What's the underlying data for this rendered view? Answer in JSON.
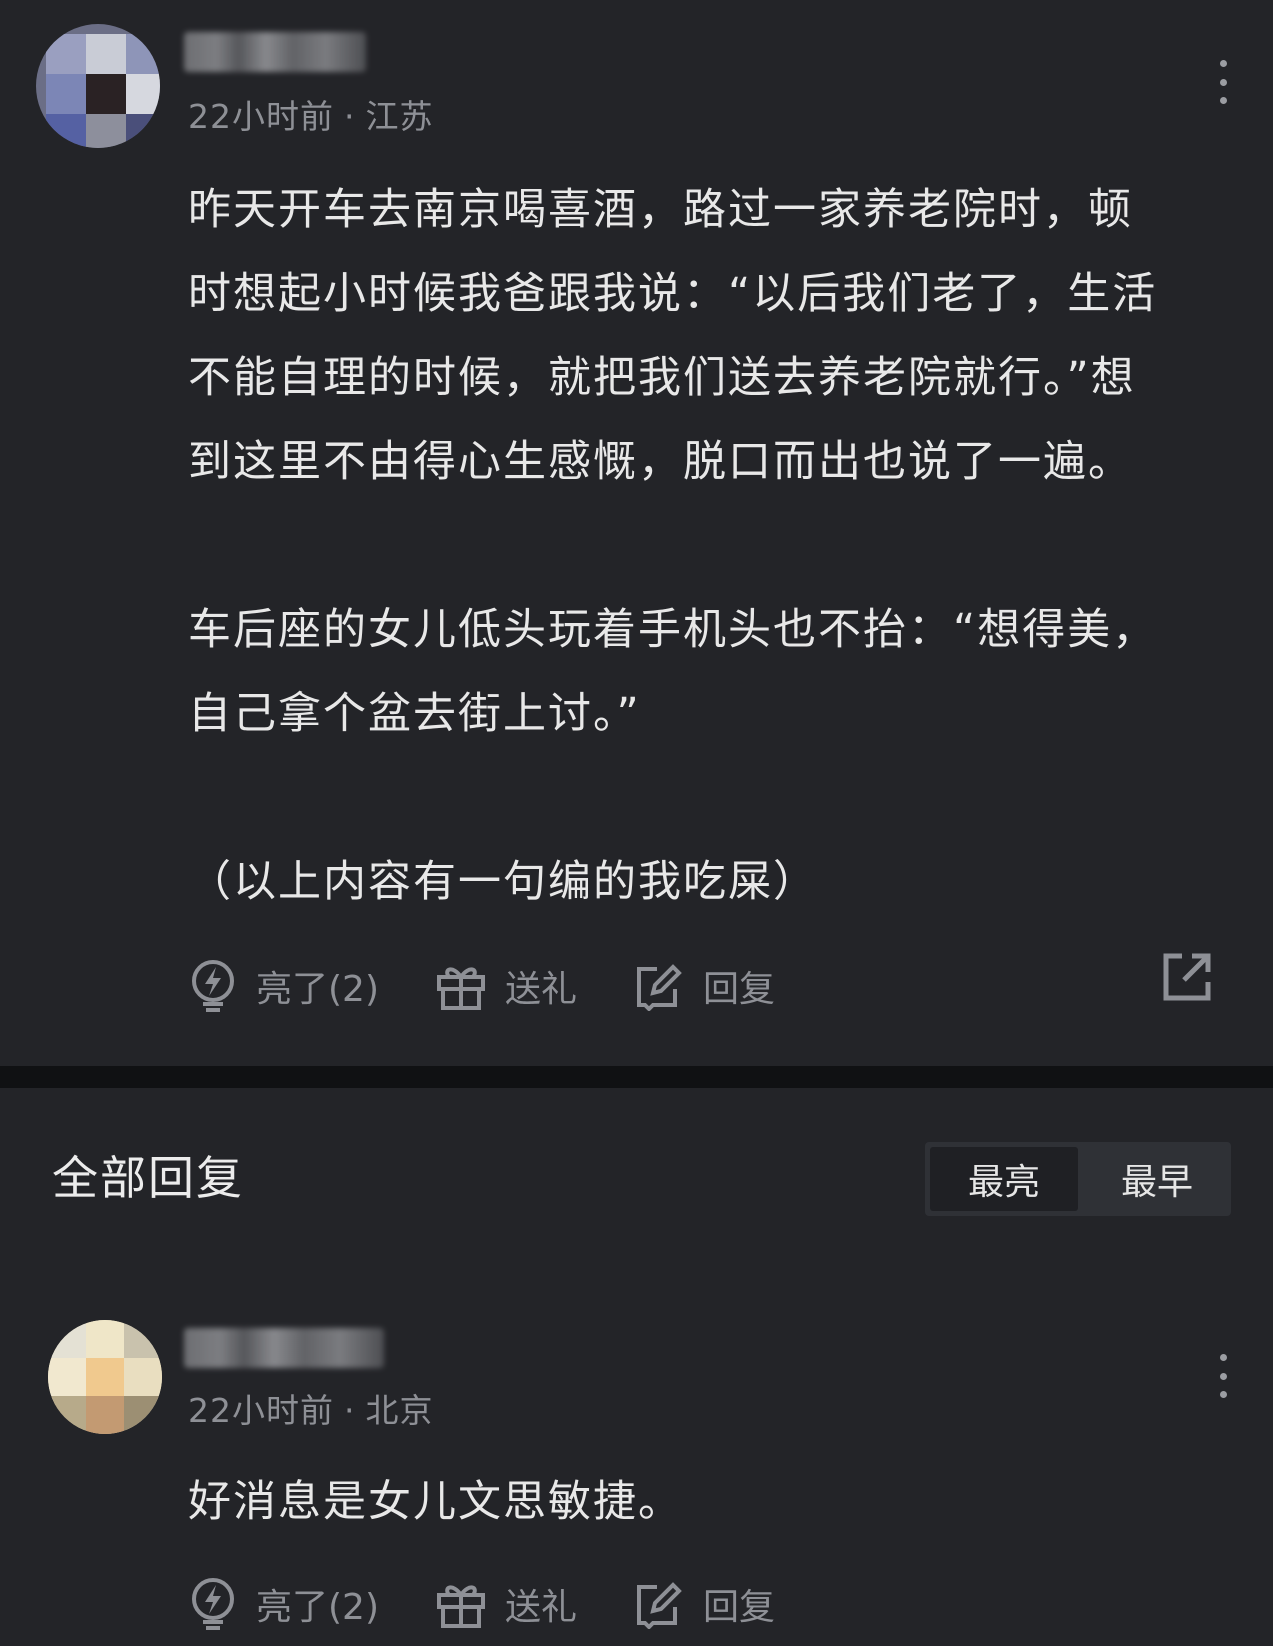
{
  "post": {
    "meta": {
      "time": "22小时前",
      "separator": "·",
      "location": "江苏"
    },
    "paragraphs": [
      "昨天开车去南京喝喜酒，路过一家养老院时，顿\n时想起小时候我爸跟我说：“以后我们老了，生活\n不能自理的时候，就把我们送去养老院就行。”想\n到这里不由得心生感慨，脱口而出也说了一遍。",
      "车后座的女儿低头玩着手机头也不抬：“想得美，\n自己拿个盆去街上讨。”",
      "（以上内容有一句编的我吃屎）"
    ],
    "actions": {
      "like": "亮了(2)",
      "gift": "送礼",
      "reply": "回复"
    }
  },
  "replies_section": {
    "title": "全部回复",
    "sort_options": [
      "最亮",
      "最早"
    ]
  },
  "reply": {
    "meta": {
      "time": "22小时前",
      "separator": "·",
      "location": "北京"
    },
    "text": "好消息是女儿文思敏捷。",
    "actions": {
      "like": "亮了(2)",
      "gift": "送礼",
      "reply": "回复"
    }
  },
  "icons": {
    "like": "lightbulb-icon",
    "gift": "gift-icon",
    "reply": "edit-icon",
    "share": "share-icon",
    "more": "more-vertical-icon"
  }
}
